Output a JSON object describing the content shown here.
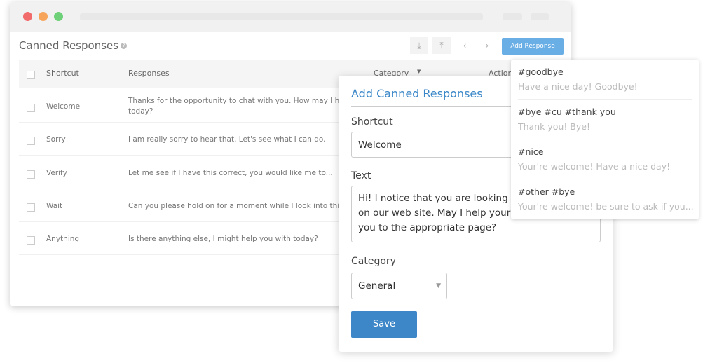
{
  "window": {
    "title": "Canned Responses",
    "add_button": "Add Response",
    "icons": [
      "download-icon",
      "upload-icon",
      "chevron-left-icon",
      "chevron-right-icon"
    ]
  },
  "table": {
    "headers": {
      "shortcut": "Shortcut",
      "responses": "Responses",
      "category": "Category",
      "actions": "Actions"
    },
    "rows": [
      {
        "shortcut": "Welcome",
        "response": "Thanks for the opportunity to chat with you. How may I help you",
        "response2": "today?"
      },
      {
        "shortcut": "Sorry",
        "response": "I am really sorry to hear that. Let's see what I can do.",
        "response2": ""
      },
      {
        "shortcut": "Verify",
        "response": "Let me see if I have this correct, you would like me to...",
        "response2": ""
      },
      {
        "shortcut": "Wait",
        "response": "Can you please hold on for a moment while I look into this for",
        "response2": ""
      },
      {
        "shortcut": "Anything",
        "response": "Is there anything else, I might help you with today?",
        "response2": ""
      }
    ]
  },
  "modal": {
    "title": "Add Canned Responses",
    "shortcut_label": "Shortcut",
    "shortcut_value": "Welcome",
    "text_label": "Text",
    "text_value": "Hi! I notice that you are looking for information on our web site. May I help your search or direct you to the appropriate page?",
    "category_label": "Category",
    "category_value": "General",
    "save": "Save"
  },
  "suggestions": [
    {
      "tags": "#goodbye",
      "text": "Have a nice day! Goodbye!"
    },
    {
      "tags": "#bye #cu #thank you",
      "text": "Thank you! Bye!"
    },
    {
      "tags": "#nice",
      "text": "Your're welcome! Have a nice day!"
    },
    {
      "tags": "#other  #bye",
      "text": "Your're welcome! be sure to ask if you..."
    }
  ],
  "colors": {
    "accent": "#3d87c9",
    "button_light": "#6aaee6"
  }
}
